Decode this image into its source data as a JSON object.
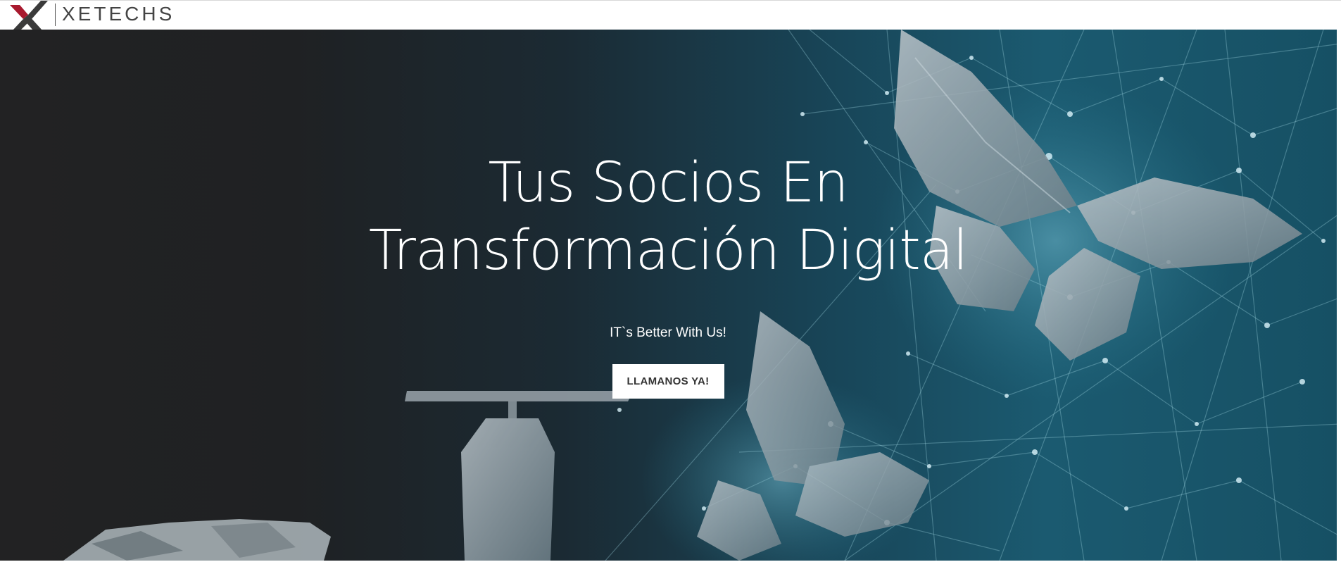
{
  "header": {
    "logo_text": "XETECHS",
    "logo_colors": {
      "red": "#a8192e",
      "dark": "#3a3a3a"
    }
  },
  "hero": {
    "title_line1": "Tus Socios En",
    "title_line2": "Transformación Digital",
    "subtitle": "IT`s Better With Us!",
    "cta_label": "LLAMANOS YA!"
  },
  "theme": {
    "hero_dark": "#222223",
    "hero_teal": "#1b5a70",
    "cta_background": "#ffffff",
    "cta_text": "#333333"
  }
}
